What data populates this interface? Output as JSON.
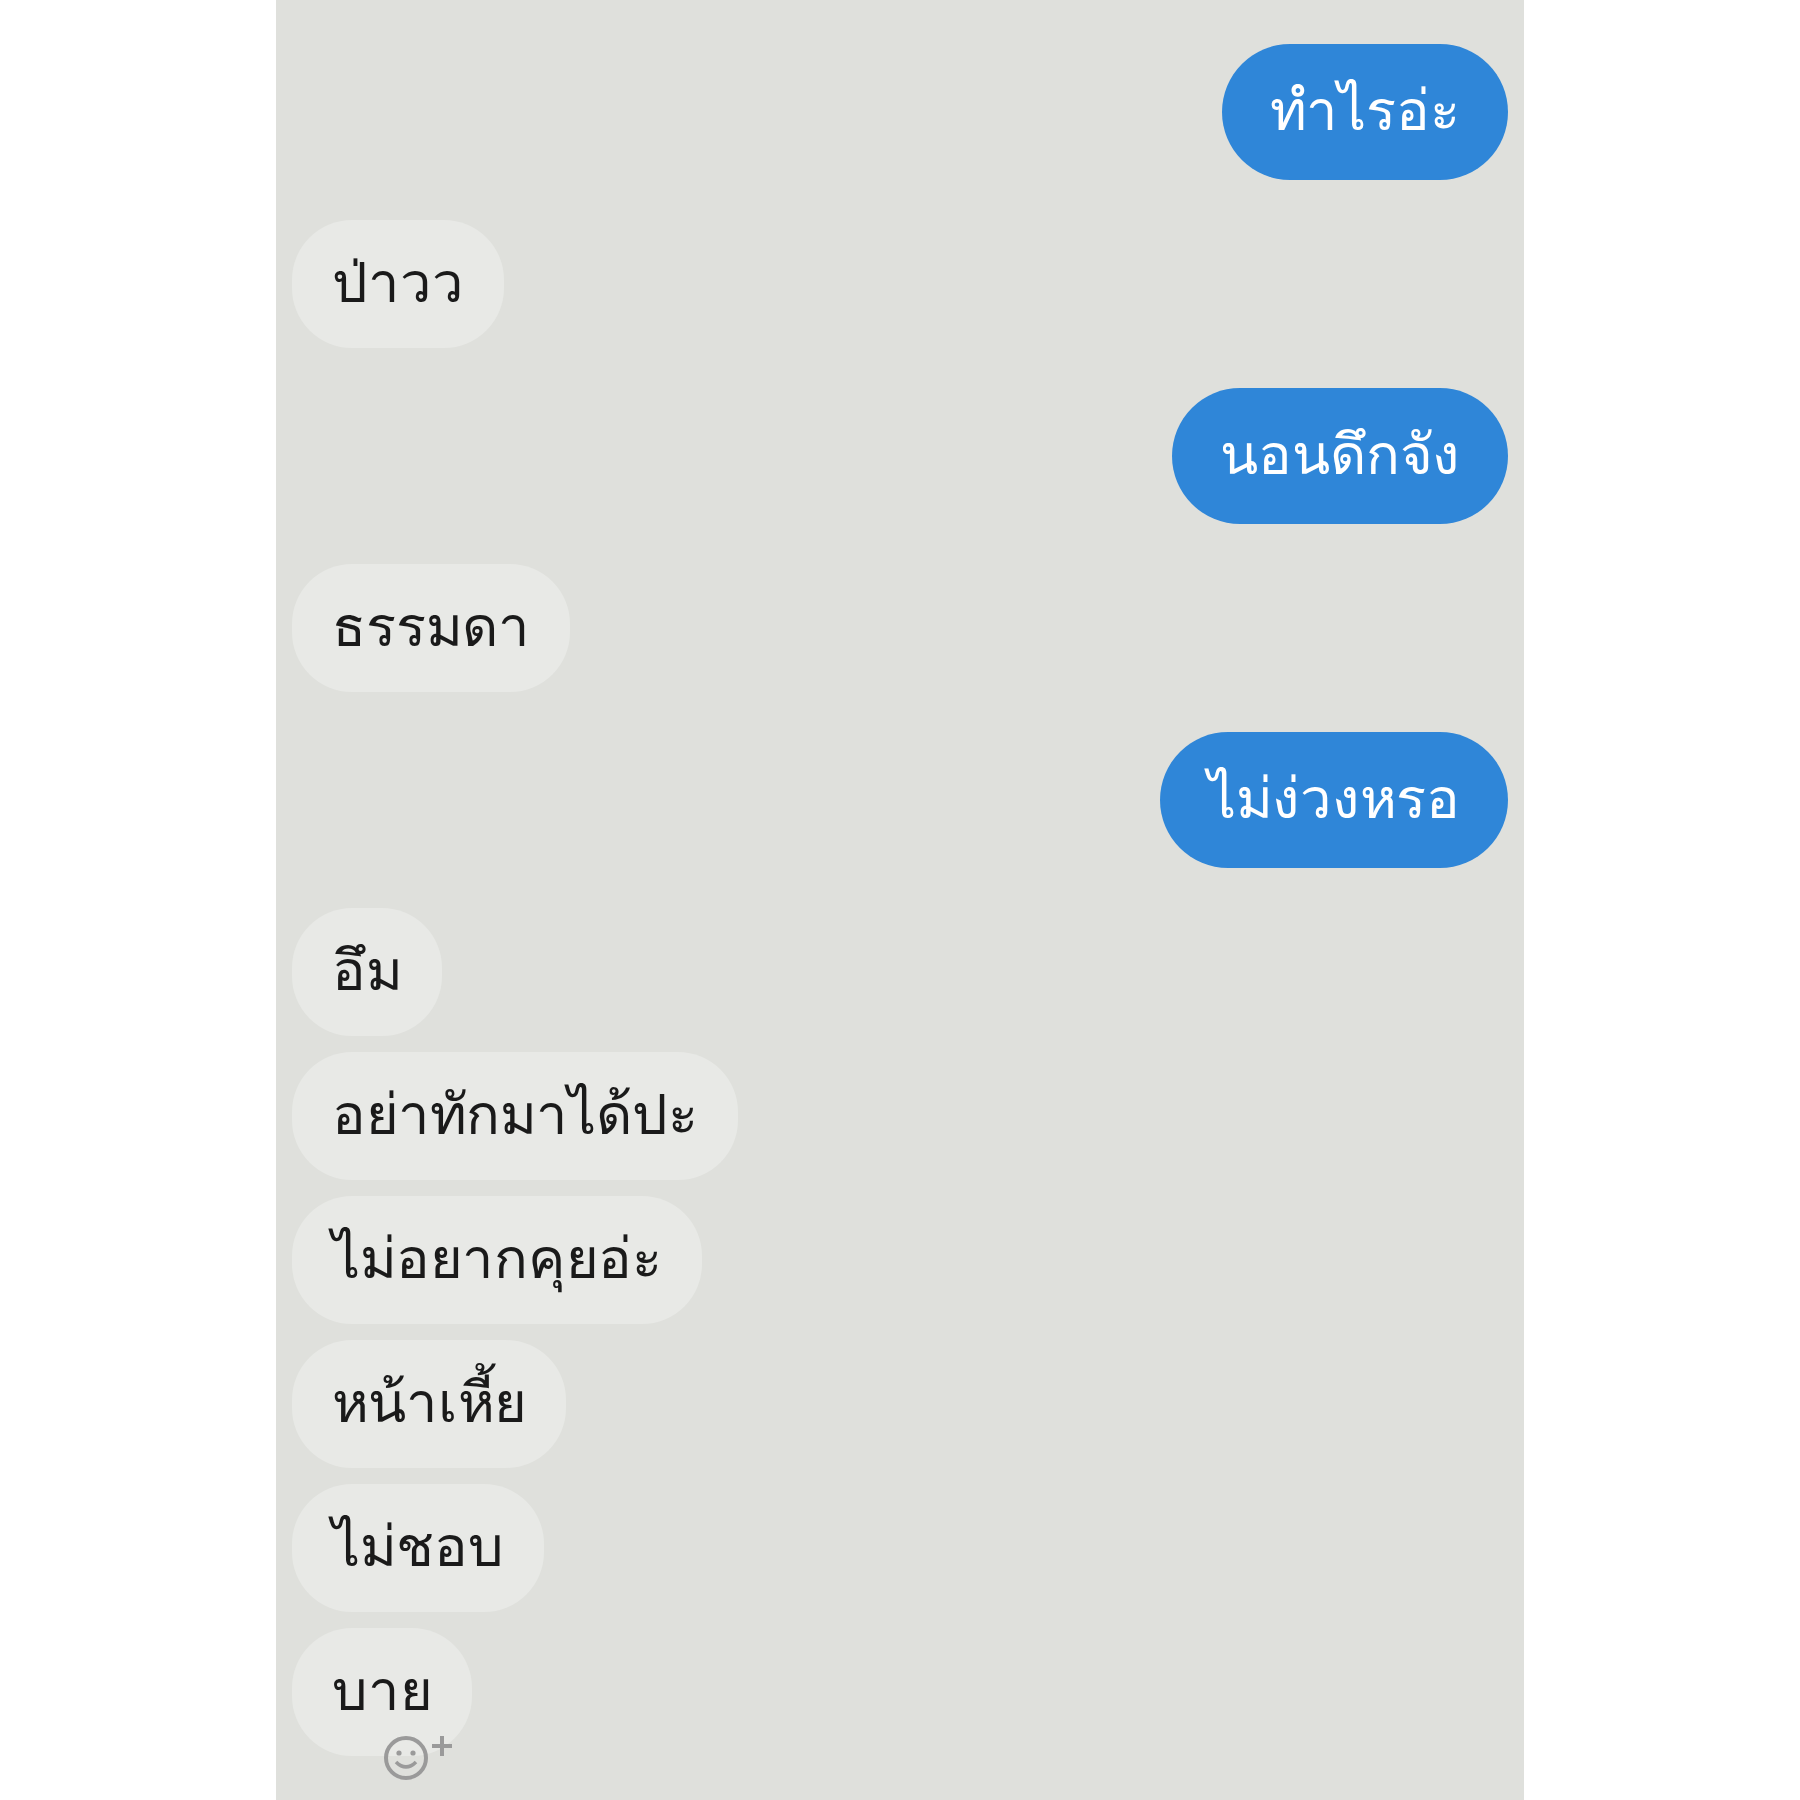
{
  "messages": [
    {
      "kind": "sent",
      "text": "ทำไรอ่ะ"
    },
    {
      "kind": "received",
      "text": "ป่าวว"
    },
    {
      "kind": "sent",
      "text": "นอนดึกจัง"
    },
    {
      "kind": "received",
      "text": "ธรรมดา"
    },
    {
      "kind": "sent",
      "text": "ไม่ง่วงหรอ"
    },
    {
      "kind": "received",
      "text": "อึม"
    },
    {
      "kind": "received",
      "text": "อย่าทักมาได้ปะ"
    },
    {
      "kind": "received",
      "text": "ไม่อยากคุยอ่ะ"
    },
    {
      "kind": "received",
      "text": "หน้าเหี้ย"
    },
    {
      "kind": "received",
      "text": "ไม่ชอบ"
    },
    {
      "kind": "received",
      "text": "บาย"
    }
  ]
}
